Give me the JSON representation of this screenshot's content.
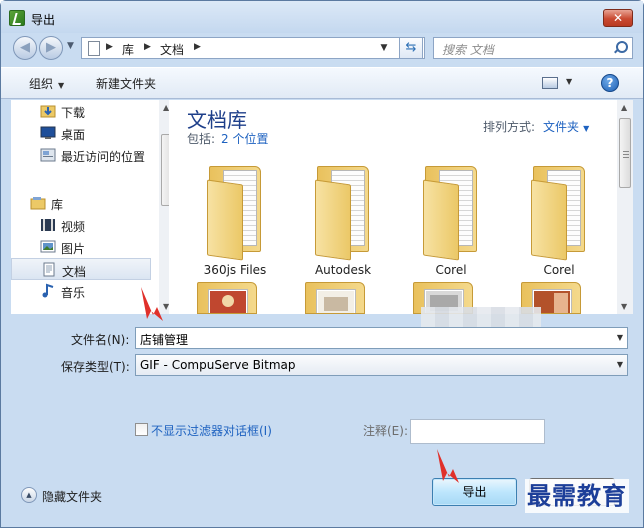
{
  "title": "导出",
  "close_label": "✕",
  "nav": {
    "breadcrumbs": [
      "库",
      "文档"
    ],
    "search_placeholder": "搜索 文档"
  },
  "toolbar": {
    "organize": "组织",
    "new_folder": "新建文件夹",
    "help": "?"
  },
  "sidebar": {
    "items": [
      {
        "label": "下载",
        "icon": "download-folder-icon"
      },
      {
        "label": "桌面",
        "icon": "desktop-icon"
      },
      {
        "label": "最近访问的位置",
        "icon": "recent-places-icon"
      },
      {
        "label": "库",
        "icon": "libraries-icon"
      },
      {
        "label": "视频",
        "icon": "videos-icon"
      },
      {
        "label": "图片",
        "icon": "pictures-icon"
      },
      {
        "label": "文档",
        "icon": "documents-icon"
      },
      {
        "label": "音乐",
        "icon": "music-icon"
      }
    ],
    "selected": "文档"
  },
  "library": {
    "title": "文档库",
    "includes_label": "包括:",
    "includes_link": "2 个位置",
    "arrange_label": "排列方式:",
    "arrange_value": "文件夹"
  },
  "folders": [
    {
      "name": "360js Files"
    },
    {
      "name": "Autodesk"
    },
    {
      "name": "Corel"
    },
    {
      "name": "Corel"
    }
  ],
  "form": {
    "filename_label": "文件名(N):",
    "filename_value": "店铺管理",
    "filetype_label": "保存类型(T):",
    "filetype_value": "GIF - CompuServe Bitmap",
    "checkbox_label": "不显示过滤器对话框(I)",
    "note_label": "注释(E):",
    "note_value": ""
  },
  "footer": {
    "hide_folders": "隐藏文件夹",
    "export_button": "导出",
    "watermark": "最需教育"
  },
  "colors": {
    "accent_red": "#e0302a",
    "link_blue": "#1e62c0",
    "library_title": "#1e3f8a"
  }
}
